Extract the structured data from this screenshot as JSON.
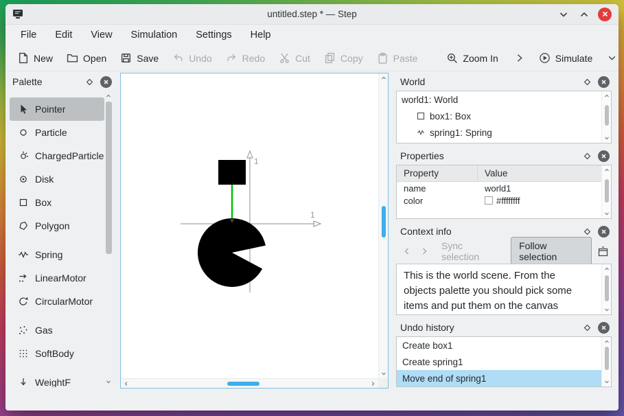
{
  "window": {
    "title": "untitled.step * — Step"
  },
  "menu": {
    "items": [
      "File",
      "Edit",
      "View",
      "Simulation",
      "Settings",
      "Help"
    ]
  },
  "toolbar": {
    "new": "New",
    "open": "Open",
    "save": "Save",
    "undo": "Undo",
    "redo": "Redo",
    "cut": "Cut",
    "copy": "Copy",
    "paste": "Paste",
    "zoom_in": "Zoom In",
    "simulate": "Simulate"
  },
  "palette": {
    "title": "Palette",
    "items": [
      {
        "label": "Pointer",
        "selected": true
      },
      {
        "label": "Particle"
      },
      {
        "label": "ChargedParticle"
      },
      {
        "label": "Disk"
      },
      {
        "label": "Box"
      },
      {
        "label": "Polygon"
      },
      {
        "label": "Spring"
      },
      {
        "label": "LinearMotor"
      },
      {
        "label": "CircularMotor"
      },
      {
        "label": "Gas"
      },
      {
        "label": "SoftBody"
      },
      {
        "label": "WeightF"
      }
    ]
  },
  "canvas": {
    "x_axis_label": "1",
    "y_axis_label": "1"
  },
  "world": {
    "title": "World",
    "items": [
      {
        "label": "world1: World",
        "indent": 0
      },
      {
        "label": "box1: Box",
        "indent": 1,
        "icon": "box"
      },
      {
        "label": "spring1: Spring",
        "indent": 1,
        "icon": "spring"
      }
    ]
  },
  "properties": {
    "title": "Properties",
    "header": {
      "property": "Property",
      "value": "Value"
    },
    "rows": [
      {
        "property": "name",
        "value": "world1"
      },
      {
        "property": "color",
        "value": "#ffffffff",
        "swatch": "#ffffff"
      }
    ]
  },
  "context": {
    "title": "Context info",
    "sync_label": "Sync selection",
    "follow_label": "Follow selection",
    "body": "This is the world scene. From the objects palette you should pick some items and put them on the canvas"
  },
  "undo_history": {
    "title": "Undo history",
    "items": [
      {
        "label": "Create box1",
        "selected": false
      },
      {
        "label": "Create spring1",
        "selected": false
      },
      {
        "label": "Move end of spring1",
        "selected": true
      }
    ]
  },
  "colors": {
    "accent": "#3daee9",
    "close_button": "#e23c3c",
    "spring": "#00c000",
    "scene_objects": "#000000",
    "undo_selected_bg": "#b0dcf5"
  }
}
